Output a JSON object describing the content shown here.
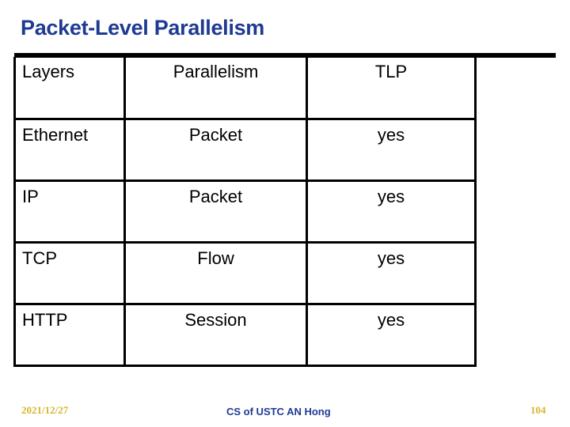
{
  "slide": {
    "title": "Packet-Level Parallelism"
  },
  "table": {
    "headers": [
      "Layers",
      "Parallelism",
      "TLP"
    ],
    "rows": [
      [
        "Ethernet",
        "Packet",
        "yes"
      ],
      [
        "IP",
        "Packet",
        "yes"
      ],
      [
        "TCP",
        "Flow",
        "yes"
      ],
      [
        "HTTP",
        "Session",
        "yes"
      ]
    ]
  },
  "footer": {
    "date": "2021/12/27",
    "center": "CS of USTC AN Hong",
    "page": "104"
  },
  "colors": {
    "title": "#1f3a93",
    "footer_accent": "#d4b72c"
  }
}
